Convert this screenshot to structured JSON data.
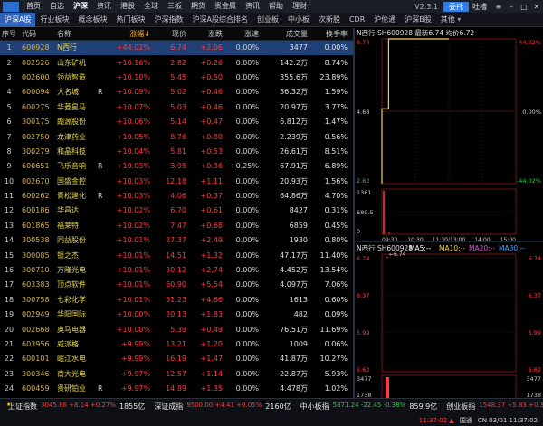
{
  "menubar": {
    "items": [
      "首页",
      "自选",
      "沪深",
      "资讯",
      "港股",
      "全球",
      "三板",
      "期货",
      "贵金属",
      "资讯",
      "帮助",
      "理财"
    ],
    "active_index": 2,
    "version": "V2.3.1",
    "login_label": "委托",
    "hint_label": "吐槽"
  },
  "tabs": {
    "items": [
      "沪深A股",
      "行业板块",
      "概念板块",
      "热门板块",
      "沪深指数",
      "沪深A股综合排名",
      "创业板",
      "中小板",
      "次新股",
      "CDR",
      "沪伦通",
      "沪深B股",
      "其他"
    ],
    "active_index": 0,
    "other_caret": "▾"
  },
  "table": {
    "headers": {
      "no": "序号",
      "code": "代码",
      "name": "名称",
      "pct": "涨幅↓",
      "price": "现价",
      "chg": "涨跌",
      "speed": "涨速",
      "vol": "成交量",
      "turn": "换手率"
    },
    "rows": [
      {
        "no": "1",
        "code": "600928",
        "name": "N西行",
        "flag": "",
        "pct": "+44.02%",
        "price": "6.74",
        "chg": "+2.06",
        "speed": "0.00%",
        "vol": "3477",
        "turn": "0.00%"
      },
      {
        "no": "2",
        "code": "002526",
        "name": "山东矿机",
        "flag": "",
        "pct": "+10.16%",
        "price": "2.82",
        "chg": "+0.26",
        "speed": "0.00%",
        "vol": "142.2万",
        "turn": "8.74%"
      },
      {
        "no": "3",
        "code": "002600",
        "name": "领益智造",
        "flag": "",
        "pct": "+10.10%",
        "price": "5.45",
        "chg": "+0.50",
        "speed": "0.00%",
        "vol": "355.6万",
        "turn": "23.89%"
      },
      {
        "no": "4",
        "code": "600094",
        "name": "大名城",
        "flag": "R",
        "pct": "+10.09%",
        "price": "5.02",
        "chg": "+0.46",
        "speed": "0.00%",
        "vol": "36.32万",
        "turn": "1.59%"
      },
      {
        "no": "5",
        "code": "600275",
        "name": "华菱星马",
        "flag": "",
        "pct": "+10.07%",
        "price": "5.03",
        "chg": "+0.46",
        "speed": "0.00%",
        "vol": "20.97万",
        "turn": "3.77%"
      },
      {
        "no": "6",
        "code": "300175",
        "name": "朗源股份",
        "flag": "",
        "pct": "+10.06%",
        "price": "5.14",
        "chg": "+0.47",
        "speed": "0.00%",
        "vol": "6.812万",
        "turn": "1.47%"
      },
      {
        "no": "7",
        "code": "002750",
        "name": "龙津药业",
        "flag": "",
        "pct": "+10.05%",
        "price": "8.76",
        "chg": "+0.80",
        "speed": "0.00%",
        "vol": "2.239万",
        "turn": "0.56%"
      },
      {
        "no": "8",
        "code": "300279",
        "name": "和晶科技",
        "flag": "",
        "pct": "+10.04%",
        "price": "5.81",
        "chg": "+0.53",
        "speed": "0.00%",
        "vol": "26.61万",
        "turn": "8.51%"
      },
      {
        "no": "9",
        "code": "600651",
        "name": "飞乐音响",
        "flag": "R",
        "pct": "+10.03%",
        "price": "3.95",
        "chg": "+0.36",
        "speed": "+0.25%",
        "vol": "67.91万",
        "turn": "6.89%"
      },
      {
        "no": "10",
        "code": "002670",
        "name": "国盛金控",
        "flag": "",
        "pct": "+10.03%",
        "price": "12.18",
        "chg": "+1.11",
        "speed": "0.00%",
        "vol": "20.93万",
        "turn": "1.56%"
      },
      {
        "no": "11",
        "code": "600262",
        "name": "青松建化",
        "flag": "R",
        "pct": "+10.03%",
        "price": "4.06",
        "chg": "+0.37",
        "speed": "0.00%",
        "vol": "64.86万",
        "turn": "4.70%"
      },
      {
        "no": "12",
        "code": "600186",
        "name": "华昌达",
        "flag": "",
        "pct": "+10.02%",
        "price": "6.70",
        "chg": "+0.61",
        "speed": "0.00%",
        "vol": "8427",
        "turn": "0.31%"
      },
      {
        "no": "13",
        "code": "601865",
        "name": "福莱特",
        "flag": "",
        "pct": "+10.02%",
        "price": "7.47",
        "chg": "+0.68",
        "speed": "0.00%",
        "vol": "6859",
        "turn": "0.45%"
      },
      {
        "no": "14",
        "code": "300538",
        "name": "同益股份",
        "flag": "",
        "pct": "+10.01%",
        "price": "27.37",
        "chg": "+2.49",
        "speed": "0.00%",
        "vol": "1930",
        "turn": "0.80%"
      },
      {
        "no": "15",
        "code": "300085",
        "name": "银之杰",
        "flag": "",
        "pct": "+10.01%",
        "price": "14.51",
        "chg": "+1.32",
        "speed": "0.00%",
        "vol": "47.17万",
        "turn": "11.40%"
      },
      {
        "no": "16",
        "code": "300710",
        "name": "万隆光电",
        "flag": "",
        "pct": "+10.01%",
        "price": "30.12",
        "chg": "+2.74",
        "speed": "0.00%",
        "vol": "4.452万",
        "turn": "13.54%"
      },
      {
        "no": "17",
        "code": "603383",
        "name": "顶点软件",
        "flag": "",
        "pct": "+10.01%",
        "price": "60.90",
        "chg": "+5.54",
        "speed": "0.00%",
        "vol": "4.097万",
        "turn": "7.06%"
      },
      {
        "no": "18",
        "code": "300758",
        "name": "七彩化学",
        "flag": "",
        "pct": "+10.01%",
        "price": "51.23",
        "chg": "+4.66",
        "speed": "0.00%",
        "vol": "1613",
        "turn": "0.60%"
      },
      {
        "no": "19",
        "code": "002949",
        "name": "华阳国际",
        "flag": "",
        "pct": "+10.00%",
        "price": "20.13",
        "chg": "+1.83",
        "speed": "0.00%",
        "vol": "482",
        "turn": "0.09%"
      },
      {
        "no": "20",
        "code": "002668",
        "name": "奥马电器",
        "flag": "",
        "pct": "+10.00%",
        "price": "5.39",
        "chg": "+0.49",
        "speed": "0.00%",
        "vol": "76.51万",
        "turn": "11.69%"
      },
      {
        "no": "21",
        "code": "603956",
        "name": "威派格",
        "flag": "",
        "pct": "+9.99%",
        "price": "13.21",
        "chg": "+1.20",
        "speed": "0.00%",
        "vol": "1009",
        "turn": "0.06%"
      },
      {
        "no": "22",
        "code": "600101",
        "name": "岷江水电",
        "flag": "",
        "pct": "+9.99%",
        "price": "16.19",
        "chg": "+1.47",
        "speed": "0.00%",
        "vol": "41.87万",
        "turn": "10.27%"
      },
      {
        "no": "23",
        "code": "300346",
        "name": "南大光电",
        "flag": "",
        "pct": "+9.97%",
        "price": "12.57",
        "chg": "+1.14",
        "speed": "0.00%",
        "vol": "22.87万",
        "turn": "5.93%"
      },
      {
        "no": "24",
        "code": "600459",
        "name": "贵研铂业",
        "flag": "R",
        "pct": "+9.97%",
        "price": "14.89",
        "chg": "+1.35",
        "speed": "0.00%",
        "vol": "4.478万",
        "turn": "1.02%"
      }
    ],
    "selected_index": 0
  },
  "intraday": {
    "title": "N西行 SH600928 最新6.74 均价6.72",
    "price_axis_left": [
      "6.74",
      "4.68",
      "2.62"
    ],
    "pct_axis_right": [
      "44.02%",
      "0.00%",
      "-44.02%"
    ],
    "volume_axis": [
      "1361",
      "680.5",
      "0"
    ],
    "time_labels": [
      "09:30",
      "10:30",
      "11:30/13:00",
      "14:00",
      "15:00"
    ],
    "price_points": [
      [
        0,
        2.62
      ],
      [
        0,
        4.75
      ],
      [
        0.1,
        4.75
      ],
      [
        0.1,
        6.74
      ],
      [
        1,
        6.74
      ]
    ],
    "volume_spike": 1361
  },
  "kline": {
    "title": "N西行 SH600928",
    "ma_labels": [
      "MA5:--",
      "MA10:--",
      "MA20:--",
      "MA30:--"
    ],
    "ma_colors": [
      "#ffffff",
      "#f5d142",
      "#e84fd8",
      "#47a2ff"
    ],
    "price_axis": [
      "6.74",
      "6.37",
      "5.99",
      "5.62"
    ],
    "peak_label": "6.74",
    "vol_axis": [
      "3477",
      "1738",
      "0"
    ],
    "date_label": "2019/03"
  },
  "statusbar": {
    "indices": [
      {
        "name": "上证指数",
        "value": "3045.86 +8.14 +0.27%",
        "amount": "1855亿",
        "color": "#ff3b3b"
      },
      {
        "name": "深证成指",
        "value": "9500.00 +4.41 +0.05%",
        "amount": "2160亿",
        "color": "#ff3b3b"
      },
      {
        "name": "中小板指",
        "value": "5871.24 -22.45 -0.38%",
        "amount": "859.9亿",
        "color": "#2ecc40"
      },
      {
        "name": "创业板指",
        "value": "1548.37 +5.83 +0.38%",
        "amount": "",
        "color": "#ff3b3b"
      }
    ],
    "line2": [
      "11:37:02 ▲",
      "国通",
      "CN 03/01 11:37:02"
    ]
  },
  "colors": {
    "up": "#ff3b3b",
    "down": "#2ecc40",
    "accent": "#2e61b8",
    "code": "#d4b24a",
    "name": "#e6d44a"
  }
}
